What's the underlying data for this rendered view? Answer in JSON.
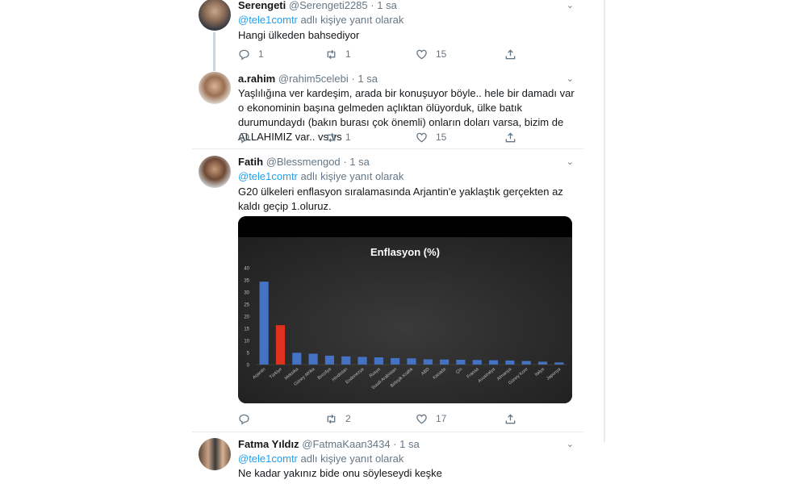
{
  "tweets": [
    {
      "name": "Serengeti",
      "handle": "@Serengeti2285",
      "time": "1 sa",
      "reply_mention": "@tele1comtr",
      "reply_suffix": " adlı kişiye yanıt olarak",
      "text": "Hangi ülkeden bahsediyor",
      "replies": "1",
      "retweets": "1",
      "likes": "15"
    },
    {
      "name": "a.rahim",
      "handle": "@rahim5celebi",
      "time": "1 sa",
      "text": "Yaşlılığına ver kardeşim, arada bir konuşuyor böyle.. hele bir damadı var o ekonominin başına gelmeden açlıktan ölüyorduk,  ülke batık durumundaydı (bakın burası çok önemli) onların doları varsa, bizim de ALLAHIMIZ var.. vs vs",
      "replies": "",
      "retweets": "1",
      "likes": "15"
    },
    {
      "name": "Fatih",
      "handle": "@Blessmengod",
      "time": "1 sa",
      "reply_mention": "@tele1comtr",
      "reply_suffix": " adlı kişiye yanıt olarak",
      "text": "G20 ülkeleri enflasyon sıralamasında Arjantin'e yaklaştık gerçekten az kaldı geçip 1.oluruz.",
      "replies": "",
      "retweets": "2",
      "likes": "17"
    },
    {
      "name": "Fatma Yıldız",
      "handle": "@FatmaKaan3434",
      "time": "1 sa",
      "reply_mention": "@tele1comtr",
      "reply_suffix": " adlı kişiye yanıt olarak",
      "text": "Ne kadar yakınız bide onu söyleseydi keşke"
    }
  ],
  "chart_data": {
    "type": "bar",
    "title": "Enflasyon (%)",
    "categories": [
      "Arjantin",
      "Türkiye",
      "Meksika",
      "Güney Afrika",
      "Brezilya",
      "Hindistan",
      "Endonezya",
      "Rusya",
      "Suudi Arabistan",
      "Birleşik Krallık",
      "ABD",
      "Kanada",
      "Çin",
      "Fransa",
      "Avustralya",
      "Almanya",
      "Güney Kore",
      "İtalya",
      "Japonya"
    ],
    "values": [
      34.3,
      16.3,
      4.9,
      4.5,
      3.7,
      3.4,
      3.2,
      3.0,
      2.7,
      2.6,
      2.2,
      2.1,
      2.0,
      1.9,
      1.8,
      1.7,
      1.5,
      1.2,
      0.9
    ],
    "highlight_category": "Türkiye",
    "yticks": [
      "0",
      "5",
      "10",
      "15",
      "20",
      "25",
      "30",
      "35",
      "40"
    ],
    "ylim": [
      0,
      40
    ],
    "colors": {
      "bar": "#4472c4",
      "highlight": "#e0301e",
      "background": "#262626",
      "axis_text": "#bfbfbf",
      "title": "#ffffff"
    }
  }
}
